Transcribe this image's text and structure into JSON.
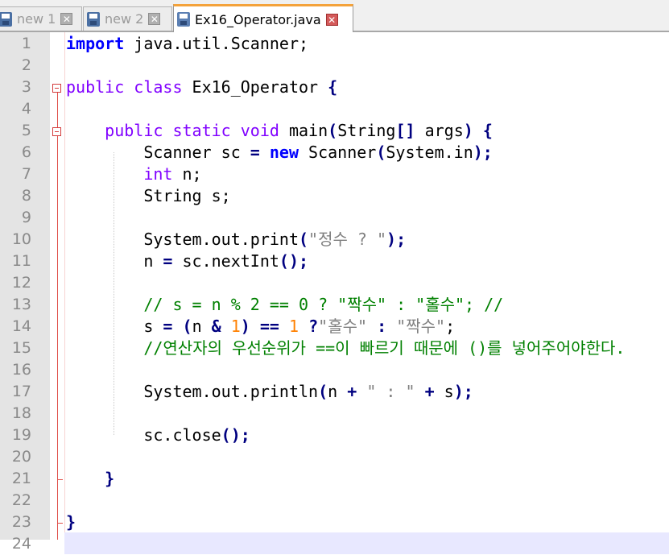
{
  "tabs": [
    {
      "label": "new 1",
      "active": false
    },
    {
      "label": "new 2",
      "active": false
    },
    {
      "label": "Ex16_Operator.java",
      "active": true
    }
  ],
  "colors": {
    "keyword": "#0000ff",
    "type": "#8000ff",
    "operator": "#000080",
    "string": "#808080",
    "number": "#ff8000",
    "comment": "#008000",
    "fold_line": "#e0504a",
    "active_tab_accent": "#f4a23a"
  },
  "icons": {
    "tab_icon": "floppy-disk-icon",
    "close": "close-icon",
    "fold": "fold-minus-icon"
  },
  "editor": {
    "lines": [
      {
        "n": "1",
        "tokens": [
          [
            "kw",
            "import"
          ],
          [
            "p",
            " java.util.Scanner;"
          ]
        ]
      },
      {
        "n": "2",
        "tokens": []
      },
      {
        "n": "3",
        "tokens": [
          [
            "ty",
            "public"
          ],
          [
            "p",
            " "
          ],
          [
            "ty",
            "class"
          ],
          [
            "p",
            " Ex16_Operator "
          ],
          [
            "op",
            "{"
          ]
        ]
      },
      {
        "n": "4",
        "tokens": []
      },
      {
        "n": "5",
        "tokens": [
          [
            "p",
            "    "
          ],
          [
            "ty",
            "public"
          ],
          [
            "p",
            " "
          ],
          [
            "ty",
            "static"
          ],
          [
            "p",
            " "
          ],
          [
            "ty",
            "void"
          ],
          [
            "p",
            " main"
          ],
          [
            "op",
            "("
          ],
          [
            "p",
            "String"
          ],
          [
            "op",
            "[]"
          ],
          [
            "p",
            " args"
          ],
          [
            "op",
            ")"
          ],
          [
            "p",
            " "
          ],
          [
            "op",
            "{"
          ]
        ]
      },
      {
        "n": "6",
        "tokens": [
          [
            "p",
            "        Scanner sc "
          ],
          [
            "op",
            "="
          ],
          [
            "p",
            " "
          ],
          [
            "kw",
            "new"
          ],
          [
            "p",
            " Scanner"
          ],
          [
            "op",
            "("
          ],
          [
            "p",
            "System.in"
          ],
          [
            "op",
            ");"
          ]
        ]
      },
      {
        "n": "7",
        "tokens": [
          [
            "p",
            "        "
          ],
          [
            "ty",
            "int"
          ],
          [
            "p",
            " n;"
          ]
        ]
      },
      {
        "n": "8",
        "tokens": [
          [
            "p",
            "        String s;"
          ]
        ]
      },
      {
        "n": "9",
        "tokens": []
      },
      {
        "n": "10",
        "tokens": [
          [
            "p",
            "        System.out.print"
          ],
          [
            "op",
            "("
          ],
          [
            "str",
            "\"정수 ? \""
          ],
          [
            "op",
            ");"
          ]
        ]
      },
      {
        "n": "11",
        "tokens": [
          [
            "p",
            "        n "
          ],
          [
            "op",
            "="
          ],
          [
            "p",
            " sc.nextInt"
          ],
          [
            "op",
            "();"
          ]
        ]
      },
      {
        "n": "12",
        "tokens": []
      },
      {
        "n": "13",
        "tokens": [
          [
            "p",
            "        "
          ],
          [
            "cmt",
            "// s = n % 2 == 0 ? \"짝수\" : \"홀수\"; //"
          ]
        ]
      },
      {
        "n": "14",
        "tokens": [
          [
            "p",
            "        s "
          ],
          [
            "op",
            "="
          ],
          [
            "p",
            " "
          ],
          [
            "op",
            "("
          ],
          [
            "p",
            "n "
          ],
          [
            "op",
            "&"
          ],
          [
            "p",
            " "
          ],
          [
            "num",
            "1"
          ],
          [
            "op",
            ")"
          ],
          [
            "p",
            " "
          ],
          [
            "op",
            "=="
          ],
          [
            "p",
            " "
          ],
          [
            "num",
            "1"
          ],
          [
            "p",
            " "
          ],
          [
            "op",
            "?"
          ],
          [
            "str",
            "\"홀수\""
          ],
          [
            "p",
            " "
          ],
          [
            "op",
            ":"
          ],
          [
            "p",
            " "
          ],
          [
            "str",
            "\"짝수\""
          ],
          [
            "p",
            ";"
          ]
        ]
      },
      {
        "n": "15",
        "tokens": [
          [
            "p",
            "        "
          ],
          [
            "cmt",
            "//연산자의 우선순위가 ==이 빠르기 때문에 ()를 넣어주어야한다."
          ]
        ]
      },
      {
        "n": "16",
        "tokens": []
      },
      {
        "n": "17",
        "tokens": [
          [
            "p",
            "        System.out.println"
          ],
          [
            "op",
            "("
          ],
          [
            "p",
            "n "
          ],
          [
            "op",
            "+"
          ],
          [
            "p",
            " "
          ],
          [
            "str",
            "\" : \""
          ],
          [
            "p",
            " "
          ],
          [
            "op",
            "+"
          ],
          [
            "p",
            " s"
          ],
          [
            "op",
            ");"
          ]
        ]
      },
      {
        "n": "18",
        "tokens": []
      },
      {
        "n": "19",
        "tokens": [
          [
            "p",
            "        sc.close"
          ],
          [
            "op",
            "();"
          ]
        ]
      },
      {
        "n": "20",
        "tokens": []
      },
      {
        "n": "21",
        "tokens": [
          [
            "p",
            "    "
          ],
          [
            "op",
            "}"
          ]
        ]
      },
      {
        "n": "22",
        "tokens": []
      },
      {
        "n": "23",
        "tokens": [
          [
            "op",
            "}"
          ]
        ]
      },
      {
        "n": "24",
        "tokens": []
      }
    ]
  }
}
